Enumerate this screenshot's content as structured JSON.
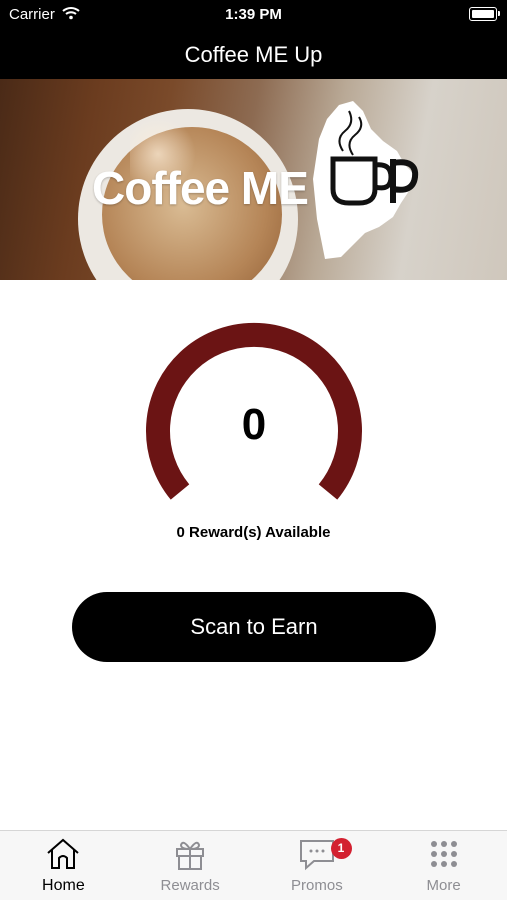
{
  "status_bar": {
    "carrier": "Carrier",
    "time": "1:39 PM"
  },
  "nav": {
    "title": "Coffee ME Up"
  },
  "hero": {
    "logo_text": "Coffee ME"
  },
  "rewards": {
    "points_value": "0",
    "available_text": "0 Reward(s) Available",
    "gauge_color": "#6b1414"
  },
  "actions": {
    "scan_label": "Scan to Earn"
  },
  "tabs": [
    {
      "label": "Home",
      "icon": "home-icon",
      "active": true
    },
    {
      "label": "Rewards",
      "icon": "gift-icon",
      "active": false
    },
    {
      "label": "Promos",
      "icon": "chat-bubble-icon",
      "active": false,
      "badge": "1"
    },
    {
      "label": "More",
      "icon": "grid-dots-icon",
      "active": false
    }
  ]
}
